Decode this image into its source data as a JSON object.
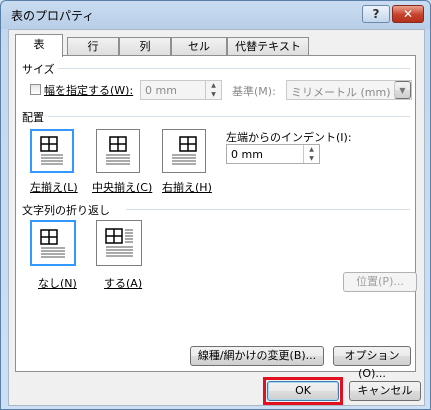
{
  "window": {
    "title": "表のプロパティ",
    "help_label": "?",
    "close_label": "✕"
  },
  "tabs": [
    {
      "label": "表",
      "active": true
    },
    {
      "label": "行"
    },
    {
      "label": "列"
    },
    {
      "label": "セル"
    },
    {
      "label": "代替テキスト"
    }
  ],
  "size": {
    "heading": "サイズ",
    "width_checkbox_label": "幅を指定する(W):",
    "width_value": "0 mm",
    "basis_label": "基準(M):",
    "basis_value": "ミリメートル (mm)"
  },
  "alignment": {
    "heading": "配置",
    "options": [
      {
        "label": "左揃え(L)",
        "selected": true,
        "icon": "align-left-icon"
      },
      {
        "label": "中央揃え(C)",
        "icon": "align-center-icon"
      },
      {
        "label": "右揃え(H)",
        "icon": "align-right-icon"
      }
    ],
    "indent_label": "左端からのインデント(I):",
    "indent_value": "0 mm"
  },
  "wrapping": {
    "heading": "文字列の折り返し",
    "options": [
      {
        "label": "なし(N)",
        "selected": true,
        "icon": "wrap-none-icon"
      },
      {
        "label": "する(A)",
        "icon": "wrap-around-icon"
      }
    ],
    "position_button": "位置(P)..."
  },
  "footer": {
    "borders_button": "線種/網かけの変更(B)...",
    "options_button": "オプション(O)...",
    "ok_button": "OK",
    "cancel_button": "キャンセル"
  }
}
